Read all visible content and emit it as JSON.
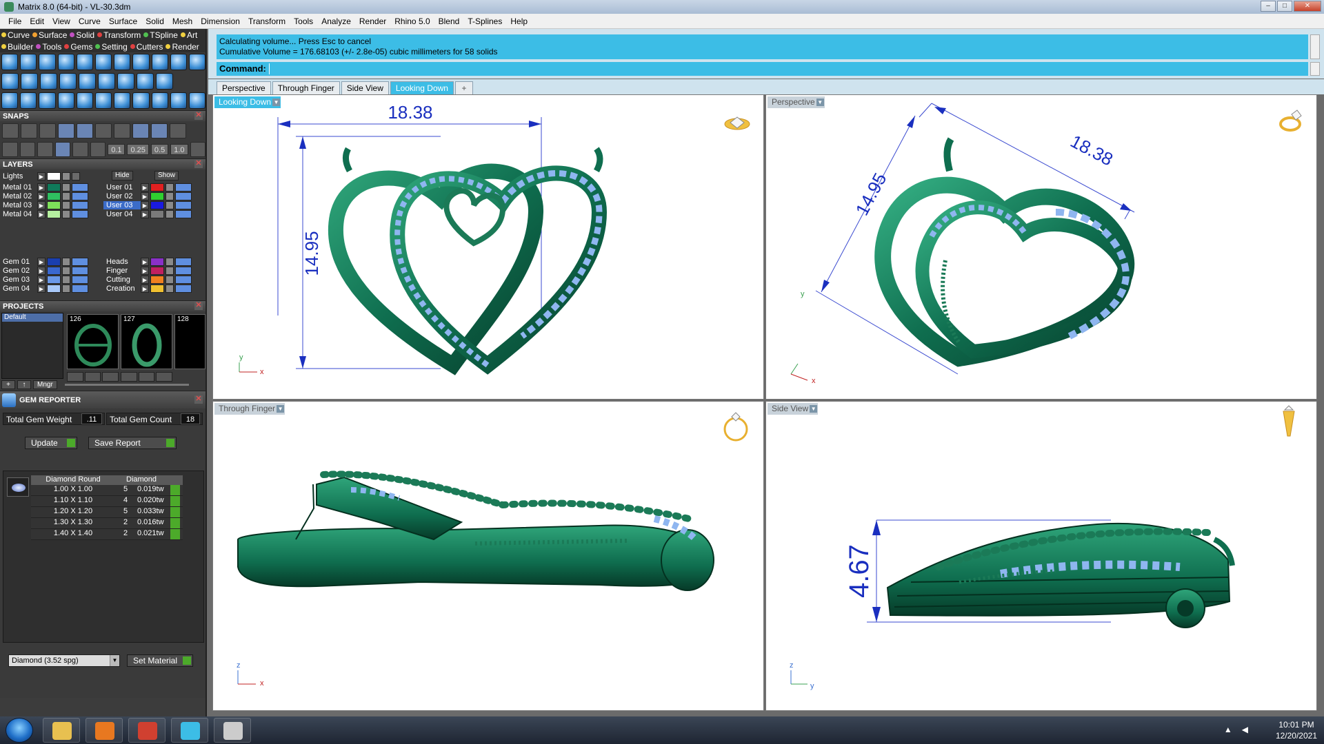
{
  "window": {
    "title": "Matrix 8.0 (64-bit) - VL-30.3dm",
    "controls": [
      "–",
      "□",
      "✕"
    ]
  },
  "menu": [
    "File",
    "Edit",
    "View",
    "Curve",
    "Surface",
    "Solid",
    "Mesh",
    "Dimension",
    "Transform",
    "Tools",
    "Analyze",
    "Render",
    "Rhino 5.0",
    "Blend",
    "T-Splines",
    "Help"
  ],
  "palettes": {
    "row1": [
      {
        "label": "Curve",
        "color": "#f0d040"
      },
      {
        "label": "Surface",
        "color": "#f0a030"
      },
      {
        "label": "Solid",
        "color": "#c050c0"
      },
      {
        "label": "Transform",
        "color": "#e04040"
      },
      {
        "label": "TSpline",
        "color": "#50c050"
      },
      {
        "label": "Art",
        "color": "#f0d040"
      }
    ],
    "row2": [
      {
        "label": "Builder",
        "color": "#f0d040"
      },
      {
        "label": "Tools",
        "color": "#c050c0"
      },
      {
        "label": "Gems",
        "color": "#e04040"
      },
      {
        "label": "Setting",
        "color": "#50c050"
      },
      {
        "label": "Cutters",
        "color": "#e04040"
      },
      {
        "label": "Render",
        "color": "#f0d040"
      }
    ]
  },
  "snaps": {
    "title": "SNAPS",
    "values": [
      "0.1",
      "0.25",
      "0.5",
      "1.0"
    ]
  },
  "layers": {
    "title": "LAYERS",
    "lights": "Lights",
    "hide": "Hide",
    "show": "Show",
    "left": [
      {
        "name": "Metal 01",
        "color": "#0f7a5a"
      },
      {
        "name": "Metal 02",
        "color": "#2fbf60"
      },
      {
        "name": "Metal 03",
        "color": "#7ee05a"
      },
      {
        "name": "Metal 04",
        "color": "#b6f0a0"
      },
      {
        "name": "Gem 01",
        "color": "#1a3fb0"
      },
      {
        "name": "Gem 02",
        "color": "#3a68d0"
      },
      {
        "name": "Gem 03",
        "color": "#6a98e8"
      },
      {
        "name": "Gem 04",
        "color": "#a8c8f8"
      }
    ],
    "right": [
      {
        "name": "User 01",
        "color": "#e02020"
      },
      {
        "name": "User 02",
        "color": "#30d030"
      },
      {
        "name": "User 03",
        "color": "#1a1ae0"
      },
      {
        "name": "User 04",
        "color": "#7a7a7a"
      },
      {
        "name": "Heads",
        "color": "#8a30c8"
      },
      {
        "name": "Finger",
        "color": "#c02060"
      },
      {
        "name": "Cutting",
        "color": "#f08020"
      },
      {
        "name": "Creation",
        "color": "#f0c030"
      }
    ],
    "selected": "User 03"
  },
  "projects": {
    "title": "PROJECTS",
    "list": [
      "Default"
    ],
    "thumbs": [
      "126",
      "127",
      "128"
    ],
    "manager": "Mngr"
  },
  "gem_reporter": {
    "title": "GEM REPORTER",
    "total_weight_label": "Total Gem Weight",
    "total_weight": ".11",
    "total_count_label": "Total Gem Count",
    "total_count": "18",
    "update": "Update",
    "save_report": "Save Report",
    "headers": [
      "Diamond Round",
      "Diamond"
    ],
    "rows": [
      {
        "size": "1.00 X 1.00",
        "count": "5",
        "weight": "0.019tw"
      },
      {
        "size": "1.10 X 1.10",
        "count": "4",
        "weight": "0.020tw"
      },
      {
        "size": "1.20 X 1.20",
        "count": "5",
        "weight": "0.033tw"
      },
      {
        "size": "1.30 X 1.30",
        "count": "2",
        "weight": "0.016tw"
      },
      {
        "size": "1.40 X 1.40",
        "count": "2",
        "weight": "0.021tw"
      }
    ],
    "material": "Diamond    (3.52 spg)",
    "set_material": "Set Material"
  },
  "command": {
    "line1": "Calculating volume... Press Esc to cancel",
    "line2": "Cumulative Volume = 176.68103 (+/- 2.8e-05) cubic millimeters for 58 solids",
    "prompt": "Command:"
  },
  "tabs": [
    "Perspective",
    "Through Finger",
    "Side View",
    "Looking Down",
    "+"
  ],
  "active_tab": "Looking Down",
  "viewports": {
    "top_left": {
      "label": "Looking Down",
      "dim_width": "18.38",
      "dim_height": "14.95",
      "axis1": "y",
      "axis2": "x"
    },
    "top_right": {
      "label": "Perspective",
      "dim_width": "18.38",
      "dim_height": "14.95",
      "axis1": "y",
      "axis2": "x"
    },
    "bottom_left": {
      "label": "Through Finger",
      "axis1": "z",
      "axis2": "x"
    },
    "bottom_right": {
      "label": "Side View",
      "dim_height": "4.67",
      "axis1": "z",
      "axis2": "y"
    }
  },
  "taskbar": {
    "time": "10:01 PM",
    "date": "12/20/2021",
    "apps": [
      {
        "name": "explorer",
        "color": "#e8c050"
      },
      {
        "name": "media-player",
        "color": "#e87820"
      },
      {
        "name": "chrome",
        "color": "#d04030"
      },
      {
        "name": "matrix",
        "color": "#3cbde6"
      },
      {
        "name": "rhino",
        "color": "#cccccc"
      }
    ]
  }
}
